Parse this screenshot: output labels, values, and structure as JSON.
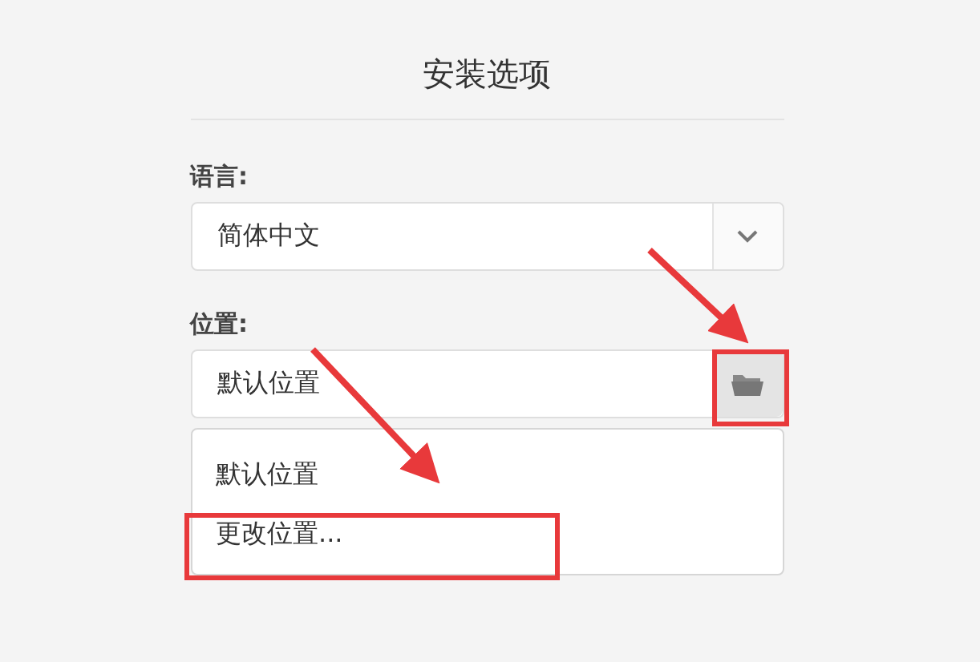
{
  "title": "安装选项",
  "language": {
    "label": "语言:",
    "value": "简体中文"
  },
  "location": {
    "label": "位置:",
    "value": "默认位置"
  },
  "location_options": [
    {
      "label": "默认位置"
    },
    {
      "label": "更改位置..."
    }
  ]
}
